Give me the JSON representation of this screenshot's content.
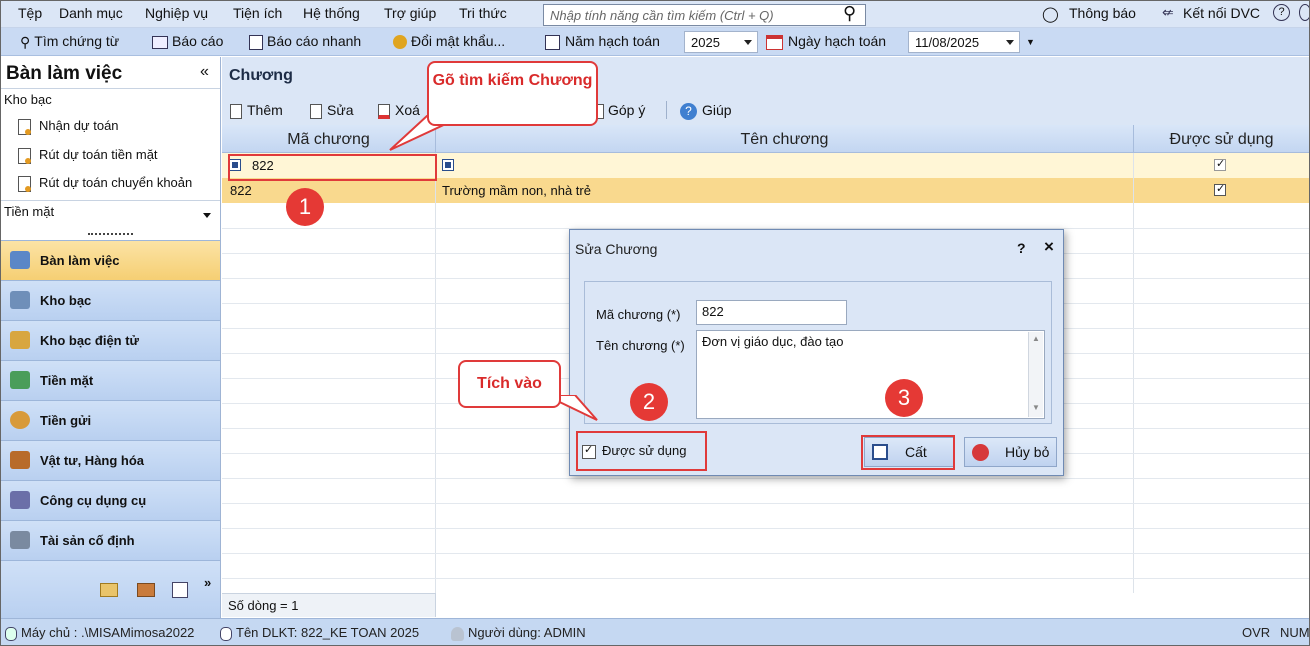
{
  "menu": {
    "items": [
      "Tệp",
      "Danh mục",
      "Nghiệp vụ",
      "Tiện ích",
      "Hệ thống",
      "Trợ giúp",
      "Tri thức"
    ],
    "search_placeholder": "Nhập tính năng cần tìm kiếm (Ctrl + Q)",
    "notifications": "Thông báo",
    "connect_dvc": "Kết nối DVC"
  },
  "toolbar": {
    "find_voucher": "Tìm chứng từ",
    "report": "Báo cáo",
    "quick_report": "Báo cáo nhanh",
    "change_password": "Đổi mật khẩu...",
    "fiscal_year_label": "Năm hạch toán",
    "fiscal_year_value": "2025",
    "posting_date_label": "Ngày hạch toán",
    "posting_date_value": "11/08/2025"
  },
  "left_panel": {
    "title": "Bàn làm việc",
    "collapse": "«",
    "section1": "Kho bạc",
    "links": [
      "Nhận dự toán",
      "Rút dự toán tiền mặt",
      "Rút dự toán chuyển khoản"
    ],
    "section2": "Tiền mặt",
    "nav": [
      {
        "label": "Bàn làm việc",
        "active": true
      },
      {
        "label": "Kho bạc",
        "active": false
      },
      {
        "label": "Kho bạc điện tử",
        "active": false
      },
      {
        "label": "Tiền mặt",
        "active": false
      },
      {
        "label": "Tiền gửi",
        "active": false
      },
      {
        "label": "Vật tư, Hàng hóa",
        "active": false
      },
      {
        "label": "Công cụ dụng cụ",
        "active": false
      },
      {
        "label": "Tài sản cố định",
        "active": false
      }
    ],
    "more": "»"
  },
  "main": {
    "title": "Chương",
    "actions": {
      "add": "Thêm",
      "edit": "Sửa",
      "delete": "Xoá",
      "feedback": "Góp ý",
      "help": "Giúp"
    },
    "columns": [
      "Mã chương",
      "Tên chương",
      "Được sử dụng"
    ],
    "filter_value": "822",
    "rows": [
      {
        "code": "822",
        "name": "Trường mầm non, nhà trẻ",
        "used": true
      }
    ],
    "row_count": "Số dòng = 1"
  },
  "dialog": {
    "title": "Sửa Chương",
    "help": "?",
    "close": "×",
    "code_label": "Mã chương (*)",
    "code_value": "822",
    "name_label": "Tên chương (*)",
    "name_value": "Đơn vị giáo dục, đào tạo",
    "used_label": "Được sử dụng",
    "used_checked": true,
    "save": "Cất",
    "cancel": "Hủy bỏ"
  },
  "annotations": {
    "callout1": "Gõ tìm kiếm Chương",
    "callout2": "Tích vào",
    "step1": "1",
    "step2": "2",
    "step3": "3"
  },
  "statusbar": {
    "server": "Máy chủ : .\\MISAMimosa2022",
    "db": "Tên DLKT: 822_KE TOAN 2025",
    "user": "Người dùng: ADMIN",
    "ovr": "OVR",
    "num": "NUM"
  },
  "colors": {
    "accent": "#c9daf3",
    "active_nav": "#f6cf73",
    "highlight_row": "#f9d98e",
    "annotation": "#e03a3a"
  }
}
